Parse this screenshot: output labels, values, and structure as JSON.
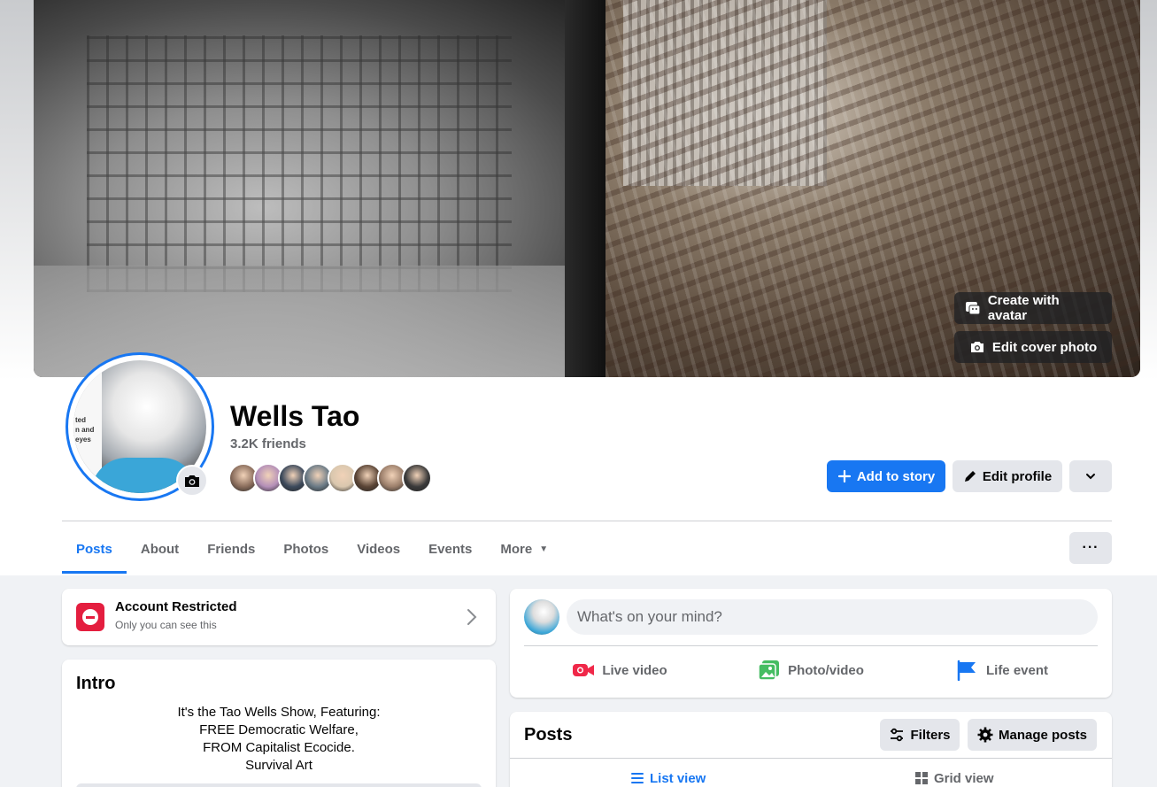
{
  "cover": {
    "create_avatar_label": "Create with avatar",
    "edit_cover_label": "Edit cover photo"
  },
  "profile": {
    "name": "Wells Tao",
    "friends_count": "3.2K friends",
    "avatar_caption": [
      "ted",
      "n and",
      "eyes"
    ],
    "friend_face_colors": [
      "#8a6d5c",
      "#b48fb8",
      "#3d4a5c",
      "#6a7a86",
      "#d9c7ae",
      "#5b4536",
      "#9c7f6b",
      "#3a3a3a"
    ]
  },
  "actions": {
    "add_story_label": "Add to story",
    "edit_profile_label": "Edit profile"
  },
  "tabs": [
    {
      "label": "Posts",
      "active": true
    },
    {
      "label": "About",
      "active": false
    },
    {
      "label": "Friends",
      "active": false
    },
    {
      "label": "Photos",
      "active": false
    },
    {
      "label": "Videos",
      "active": false
    },
    {
      "label": "Events",
      "active": false
    },
    {
      "label": "More",
      "active": false
    }
  ],
  "more_dots": "···",
  "restricted": {
    "title": "Account Restricted",
    "subtitle": "Only you can see this"
  },
  "intro": {
    "title": "Intro",
    "bio_lines": [
      "It's the Tao Wells Show, Featuring:",
      "FREE Democratic Welfare,",
      "FROM Capitalist Ecocide.",
      "Survival Art"
    ]
  },
  "composer": {
    "placeholder": "What's on your mind?",
    "live_video_label": "Live video",
    "photo_video_label": "Photo/video",
    "life_event_label": "Life event"
  },
  "posts": {
    "title": "Posts",
    "filters_label": "Filters",
    "manage_label": "Manage posts",
    "list_view_label": "List view",
    "grid_view_label": "Grid view"
  },
  "colors": {
    "accent": "#1877f2",
    "restricted": "#e41e3f",
    "live": "#f02849",
    "photo": "#45bd62",
    "life_event": "#1877f2"
  }
}
